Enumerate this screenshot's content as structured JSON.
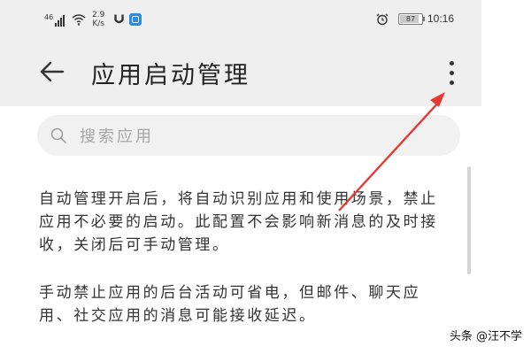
{
  "status_bar": {
    "signal_label": "46",
    "net_speed_value": "2.9",
    "net_speed_unit": "K/s",
    "battery_percent": "87",
    "battery_level": 0.87,
    "time": "10:16",
    "icons": [
      "signal-icon",
      "wifi-icon",
      "u-icon",
      "app-icon",
      "alarm-icon",
      "battery-icon"
    ]
  },
  "header": {
    "title": "应用启动管理",
    "back_icon": "back-arrow-icon",
    "more_icon": "more-vertical-icon"
  },
  "search": {
    "placeholder": "搜索应用",
    "value": ""
  },
  "content": {
    "paragraph1": "自动管理开启后，将自动识别应用和使用场景，禁止应用不必要的启动。此配置不会影响新消息的及时接收，关闭后可手动管理。",
    "paragraph2": "手动禁止应用的后台活动可省电，但邮件、聊天应用、社交应用的消息可能接收延迟。"
  },
  "annotation": {
    "arrow_color": "#e53935"
  },
  "watermark": "头条 @汪不学",
  "colors": {
    "header_bg": "#efefef",
    "search_bg": "#f1f1f1",
    "text": "#333333"
  }
}
